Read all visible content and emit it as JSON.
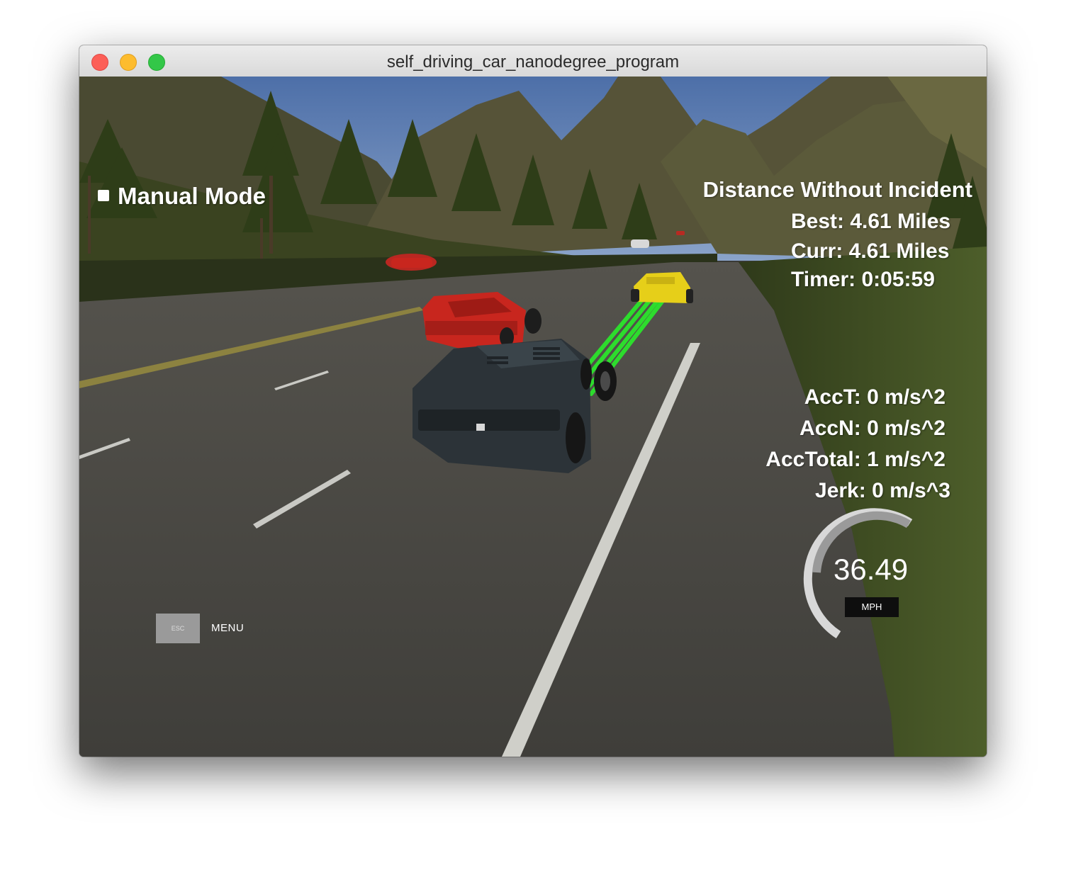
{
  "window": {
    "title": "self_driving_car_nanodegree_program"
  },
  "hud": {
    "mode_label": "Manual Mode",
    "distance_heading": "Distance Without Incident",
    "best": "Best: 4.61 Miles",
    "curr": "Curr: 4.61 Miles",
    "timer": "Timer: 0:05:59",
    "acc_t": "AccT: 0 m/s^2",
    "acc_n": "AccN: 0 m/s^2",
    "acc_total": "AccTotal: 1 m/s^2",
    "jerk": "Jerk: 0 m/s^3"
  },
  "speedometer": {
    "value": "36.49",
    "unit": "MPH",
    "fraction": 0.45
  },
  "menu": {
    "esc_label": "ESC",
    "label": "MENU"
  },
  "colors": {
    "sky": "#5f7fb6",
    "road": "#4a4945",
    "grass": "#3d4a22",
    "ego_car": "#2c3338",
    "red_car": "#c8261e",
    "yellow_car": "#e8d41a",
    "path": "#2ddc2d"
  }
}
